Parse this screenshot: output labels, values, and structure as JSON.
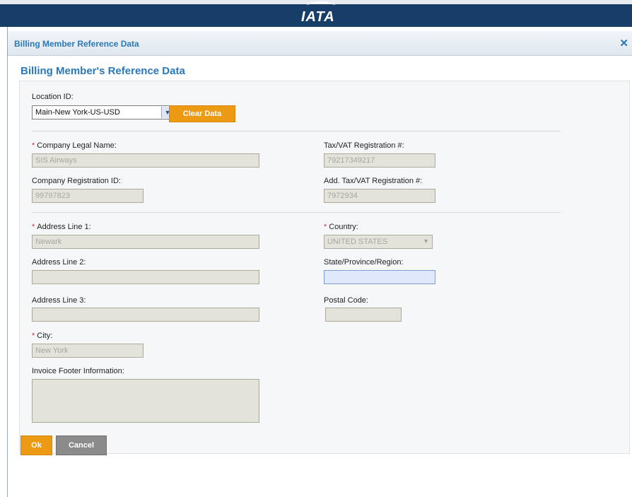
{
  "app": {
    "brand": "IATA",
    "dialog_title": "Billing Member Reference Data",
    "close_glyph": "✕"
  },
  "section_title": "Billing Member's Reference Data",
  "location": {
    "label": "Location ID:",
    "value": "Main-New York-US-USD",
    "clear_label": "Clear Data"
  },
  "company": {
    "legal_name_label": "Company Legal Name:",
    "legal_name_value": "SIS Airways",
    "tax_label": "Tax/VAT Registration #:",
    "tax_value": "79217349217",
    "reg_id_label": "Company Registration ID:",
    "reg_id_value": "99797823",
    "add_tax_label": "Add. Tax/VAT Registration #:",
    "add_tax_value": "7972934"
  },
  "address": {
    "line1_label": "Address Line 1:",
    "line1_value": "Newark",
    "line2_label": "Address Line 2:",
    "line2_value": "",
    "line3_label": "Address Line 3:",
    "line3_value": "",
    "city_label": "City:",
    "city_value": "New York",
    "country_label": "Country:",
    "country_value": "UNITED STATES",
    "state_label": "State/Province/Region:",
    "state_value": "",
    "postal_label": "Postal Code:",
    "postal_value": "",
    "footer_label": "Invoice Footer Information:",
    "footer_value": ""
  },
  "required_marker": "*",
  "actions": {
    "ok_label": "Ok",
    "cancel_label": "Cancel"
  },
  "colors": {
    "header_bar": "#163e66",
    "accent": "#2a78b8",
    "button_primary": "#ec9a14",
    "button_secondary": "#8b8b8b"
  },
  "icons": {
    "close": "close-icon",
    "dropdown": "chevron-down-icon"
  }
}
